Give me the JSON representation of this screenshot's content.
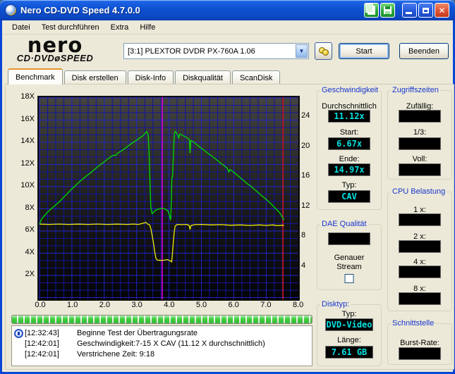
{
  "window": {
    "title": "Nero CD-DVD Speed 4.7.0.0"
  },
  "titlebar_icons": [
    "copy-icon",
    "save-icon",
    "minimize-icon",
    "maximize-icon",
    "close-icon"
  ],
  "menu": {
    "items": [
      "Datei",
      "Test durchführen",
      "Extra",
      "Hilfe"
    ]
  },
  "header": {
    "logo_line1": "nero",
    "logo_line2": "CD·DVDøSPEED",
    "drive_select": "[3:1]   PLEXTOR DVDR   PX-760A 1.06",
    "eject_icon": "eject-disc-icon",
    "start_label": "Start",
    "quit_label": "Beenden"
  },
  "tabs": [
    {
      "label": "Benchmark",
      "active": true
    },
    {
      "label": "Disk erstellen",
      "active": false
    },
    {
      "label": "Disk-Info",
      "active": false
    },
    {
      "label": "Diskqualität",
      "active": false
    },
    {
      "label": "ScanDisk",
      "active": false
    }
  ],
  "chart_data": {
    "type": "line",
    "title": "",
    "xlabel": "",
    "ylabel": "",
    "x_axis": {
      "ticks": [
        "0.0",
        "1.0",
        "2.0",
        "3.0",
        "4.0",
        "5.0",
        "6.0",
        "7.0",
        "8.0"
      ],
      "range": [
        0,
        8
      ]
    },
    "y_axis_left": {
      "ticks": [
        "2X",
        "4X",
        "6X",
        "8X",
        "10X",
        "12X",
        "14X",
        "16X",
        "18X"
      ],
      "range": [
        0,
        18
      ]
    },
    "y_axis_right": {
      "ticks": [
        "24",
        "20",
        "16",
        "12",
        "8",
        "4"
      ]
    },
    "grid": true,
    "colors": {
      "grid_minor": "#14149c",
      "grid_major": "#2424cc",
      "marker_layer": "#dd00dd",
      "marker_end": "#cc1414"
    },
    "markers": {
      "layer_break_x": 3.79,
      "end_x": 7.52
    },
    "series": [
      {
        "name": "rotation-speed",
        "color": "#eded00",
        "points": [
          [
            0,
            6.62
          ],
          [
            0.3,
            6.6
          ],
          [
            0.6,
            6.63
          ],
          [
            0.9,
            6.6
          ],
          [
            1.2,
            6.62
          ],
          [
            1.5,
            6.6
          ],
          [
            1.8,
            6.63
          ],
          [
            2.1,
            6.6
          ],
          [
            2.4,
            6.62
          ],
          [
            2.7,
            6.6
          ],
          [
            2.9,
            6.63
          ],
          [
            3.05,
            6.6
          ],
          [
            3.2,
            6.7
          ],
          [
            3.28,
            6.78
          ],
          [
            3.33,
            6.65
          ],
          [
            3.4,
            6.55
          ],
          [
            3.44,
            6.2
          ],
          [
            3.48,
            5.6
          ],
          [
            3.52,
            4.9
          ],
          [
            3.56,
            4.1
          ],
          [
            3.6,
            3.5
          ],
          [
            3.64,
            3.38
          ],
          [
            3.75,
            3.35
          ],
          [
            3.85,
            3.37
          ],
          [
            3.95,
            3.42
          ],
          [
            4.0,
            3.35
          ],
          [
            4.05,
            3.3
          ],
          [
            4.08,
            3.2
          ],
          [
            4.1,
            3.8
          ],
          [
            4.13,
            4.9
          ],
          [
            4.16,
            5.9
          ],
          [
            4.19,
            6.45
          ],
          [
            4.25,
            6.6
          ],
          [
            4.4,
            6.58
          ],
          [
            4.55,
            6.6
          ],
          [
            4.62,
            6.5
          ],
          [
            4.65,
            6.15
          ],
          [
            4.68,
            6.5
          ],
          [
            4.8,
            6.58
          ],
          [
            5.0,
            6.6
          ],
          [
            5.3,
            6.55
          ],
          [
            5.6,
            6.58
          ],
          [
            5.9,
            6.52
          ],
          [
            6.2,
            6.55
          ],
          [
            6.5,
            6.5
          ],
          [
            6.8,
            6.55
          ],
          [
            7.0,
            6.5
          ],
          [
            7.2,
            6.55
          ],
          [
            7.35,
            6.48
          ],
          [
            7.5,
            6.52
          ],
          [
            7.55,
            6.5
          ]
        ]
      },
      {
        "name": "transfer-rate",
        "color": "#00dd00",
        "points": [
          [
            0,
            6.6
          ],
          [
            0.05,
            7.0
          ],
          [
            0.1,
            7.2
          ],
          [
            0.2,
            7.55
          ],
          [
            0.3,
            7.85
          ],
          [
            0.4,
            8.1
          ],
          [
            0.5,
            8.35
          ],
          [
            0.6,
            8.6
          ],
          [
            0.7,
            8.9
          ],
          [
            0.8,
            9.2
          ],
          [
            0.9,
            9.5
          ],
          [
            1.0,
            9.8
          ],
          [
            1.2,
            10.35
          ],
          [
            1.4,
            10.85
          ],
          [
            1.6,
            11.3
          ],
          [
            1.8,
            11.8
          ],
          [
            2.0,
            12.25
          ],
          [
            2.2,
            12.7
          ],
          [
            2.3,
            12.85
          ],
          [
            2.35,
            12.8
          ],
          [
            2.4,
            13.0
          ],
          [
            2.6,
            13.35
          ],
          [
            2.8,
            13.8
          ],
          [
            3.0,
            14.2
          ],
          [
            3.1,
            14.4
          ],
          [
            3.2,
            14.6
          ],
          [
            3.3,
            14.95
          ],
          [
            3.33,
            14.9
          ],
          [
            3.36,
            14.55
          ],
          [
            3.38,
            13.5
          ],
          [
            3.4,
            11.5
          ],
          [
            3.42,
            9.5
          ],
          [
            3.44,
            8.1
          ],
          [
            3.48,
            7.55
          ],
          [
            3.52,
            7.7
          ],
          [
            3.6,
            7.9
          ],
          [
            3.7,
            8.0
          ],
          [
            3.8,
            8.05
          ],
          [
            3.9,
            7.95
          ],
          [
            3.97,
            7.8
          ],
          [
            4.0,
            7.5
          ],
          [
            4.03,
            7.2
          ],
          [
            4.05,
            7.0
          ],
          [
            4.07,
            8.5
          ],
          [
            4.09,
            10.85
          ],
          [
            4.11,
            10.9
          ],
          [
            4.13,
            12.5
          ],
          [
            4.15,
            14.0
          ],
          [
            4.17,
            14.85
          ],
          [
            4.2,
            15.0
          ],
          [
            4.24,
            14.8
          ],
          [
            4.28,
            14.55
          ],
          [
            4.3,
            14.35
          ],
          [
            4.33,
            14.75
          ],
          [
            4.4,
            14.65
          ],
          [
            4.5,
            14.5
          ],
          [
            4.58,
            14.35
          ],
          [
            4.63,
            14.25
          ],
          [
            4.65,
            13.05
          ],
          [
            4.67,
            14.15
          ],
          [
            4.75,
            14.05
          ],
          [
            4.85,
            13.8
          ],
          [
            5.0,
            13.45
          ],
          [
            5.1,
            13.25
          ],
          [
            5.2,
            13.0
          ],
          [
            5.35,
            12.7
          ],
          [
            5.5,
            12.35
          ],
          [
            5.6,
            12.1
          ],
          [
            5.7,
            11.9
          ],
          [
            5.8,
            11.65
          ],
          [
            5.85,
            11.3
          ],
          [
            5.88,
            11.55
          ],
          [
            6.0,
            11.3
          ],
          [
            6.1,
            11.05
          ],
          [
            6.2,
            10.8
          ],
          [
            6.3,
            10.55
          ],
          [
            6.4,
            10.3
          ],
          [
            6.5,
            10.1
          ],
          [
            6.6,
            9.85
          ],
          [
            6.7,
            9.6
          ],
          [
            6.8,
            9.35
          ],
          [
            6.9,
            9.1
          ],
          [
            7.0,
            8.85
          ],
          [
            7.1,
            8.6
          ],
          [
            7.2,
            8.3
          ],
          [
            7.3,
            8.0
          ],
          [
            7.4,
            7.7
          ],
          [
            7.45,
            7.5
          ],
          [
            7.5,
            7.25
          ],
          [
            7.55,
            7.0
          ]
        ]
      }
    ]
  },
  "panels": {
    "geschwindigkeit": {
      "title": "Geschwindigkeit",
      "avg_label": "Durchschnittlich",
      "avg": "11.12x",
      "start_label": "Start:",
      "start": "6.67x",
      "end_label": "Ende:",
      "end": "14.97x",
      "type_label": "Typ:",
      "type": "CAV"
    },
    "zugriffszeiten": {
      "title": "Zugriffszeiten",
      "random_label": "Zufällig:",
      "random": "",
      "third_label": "1/3:",
      "third": "",
      "full_label": "Voll:",
      "full": ""
    },
    "dae": {
      "title": "DAE Qualität",
      "value": "",
      "accurate_line1": "Genauer",
      "accurate_line2": "Stream",
      "checkbox_checked": false
    },
    "cpu": {
      "title": "CPU Belastung",
      "x1_label": "1 x:",
      "x1": "",
      "x2_label": "2 x:",
      "x2": "",
      "x4_label": "4 x:",
      "x4": "",
      "x8_label": "8 x:",
      "x8": ""
    },
    "disktyp": {
      "title": "Disktyp:",
      "type_label": "Typ:",
      "type": "DVD-Video",
      "length_label": "Länge:",
      "length": "7.61 GB"
    },
    "schnittstelle": {
      "title": "Schnittstelle",
      "burst_label": "Burst-Rate:",
      "burst": ""
    }
  },
  "progress": {
    "percent": 100
  },
  "log": {
    "entries": [
      {
        "icon": true,
        "time": "[12:32:43]",
        "text": "Beginne Test der Übertragungsrate"
      },
      {
        "icon": false,
        "time": "[12:42:01]",
        "text": "Geschwindigkeit:7-15 X CAV (11.12 X durchschnittlich)"
      },
      {
        "icon": false,
        "time": "[12:42:01]",
        "text": "Verstrichene Zeit:  9:18"
      }
    ]
  },
  "colors": {
    "lcd_text": "#00e2e2",
    "group_title": "#1636ce",
    "active_tab_accent": "#e5932f"
  }
}
